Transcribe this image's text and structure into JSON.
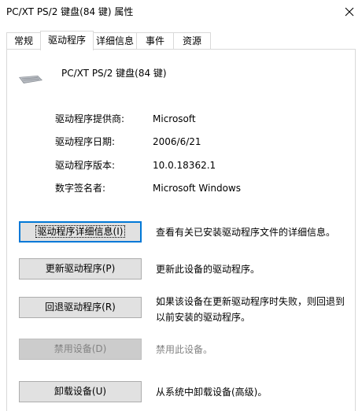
{
  "window": {
    "title": "PC/XT PS/2 键盘(84 键) 属性"
  },
  "tabs": [
    {
      "label": "常规"
    },
    {
      "label": "驱动程序",
      "active": true
    },
    {
      "label": "详细信息"
    },
    {
      "label": "事件"
    },
    {
      "label": "资源"
    }
  ],
  "device": {
    "name": "PC/XT PS/2 键盘(84 键)",
    "icon": "keyboard-icon"
  },
  "driver_info": [
    {
      "label": "驱动程序提供商:",
      "value": "Microsoft"
    },
    {
      "label": "驱动程序日期:",
      "value": "2006/6/21"
    },
    {
      "label": "驱动程序版本:",
      "value": "10.0.18362.1"
    },
    {
      "label": "数字签名者:",
      "value": "Microsoft Windows"
    }
  ],
  "actions": [
    {
      "button": "驱动程序详细信息(I)",
      "description": "查看有关已安装驱动程序文件的详细信息。",
      "focused": true
    },
    {
      "button": "更新驱动程序(P)",
      "description": "更新此设备的驱动程序。"
    },
    {
      "button": "回退驱动程序(R)",
      "description": "如果该设备在更新驱动程序时失败，则回退到以前安装的驱动程序。"
    },
    {
      "button": "禁用设备(D)",
      "description": "禁用此设备。",
      "disabled": true
    },
    {
      "button": "卸载设备(U)",
      "description": "从系统中卸载设备(高级)。"
    }
  ],
  "colors": {
    "focus_border": "#0078d7",
    "button_face": "#e1e1e1",
    "disabled_text": "#838383"
  }
}
